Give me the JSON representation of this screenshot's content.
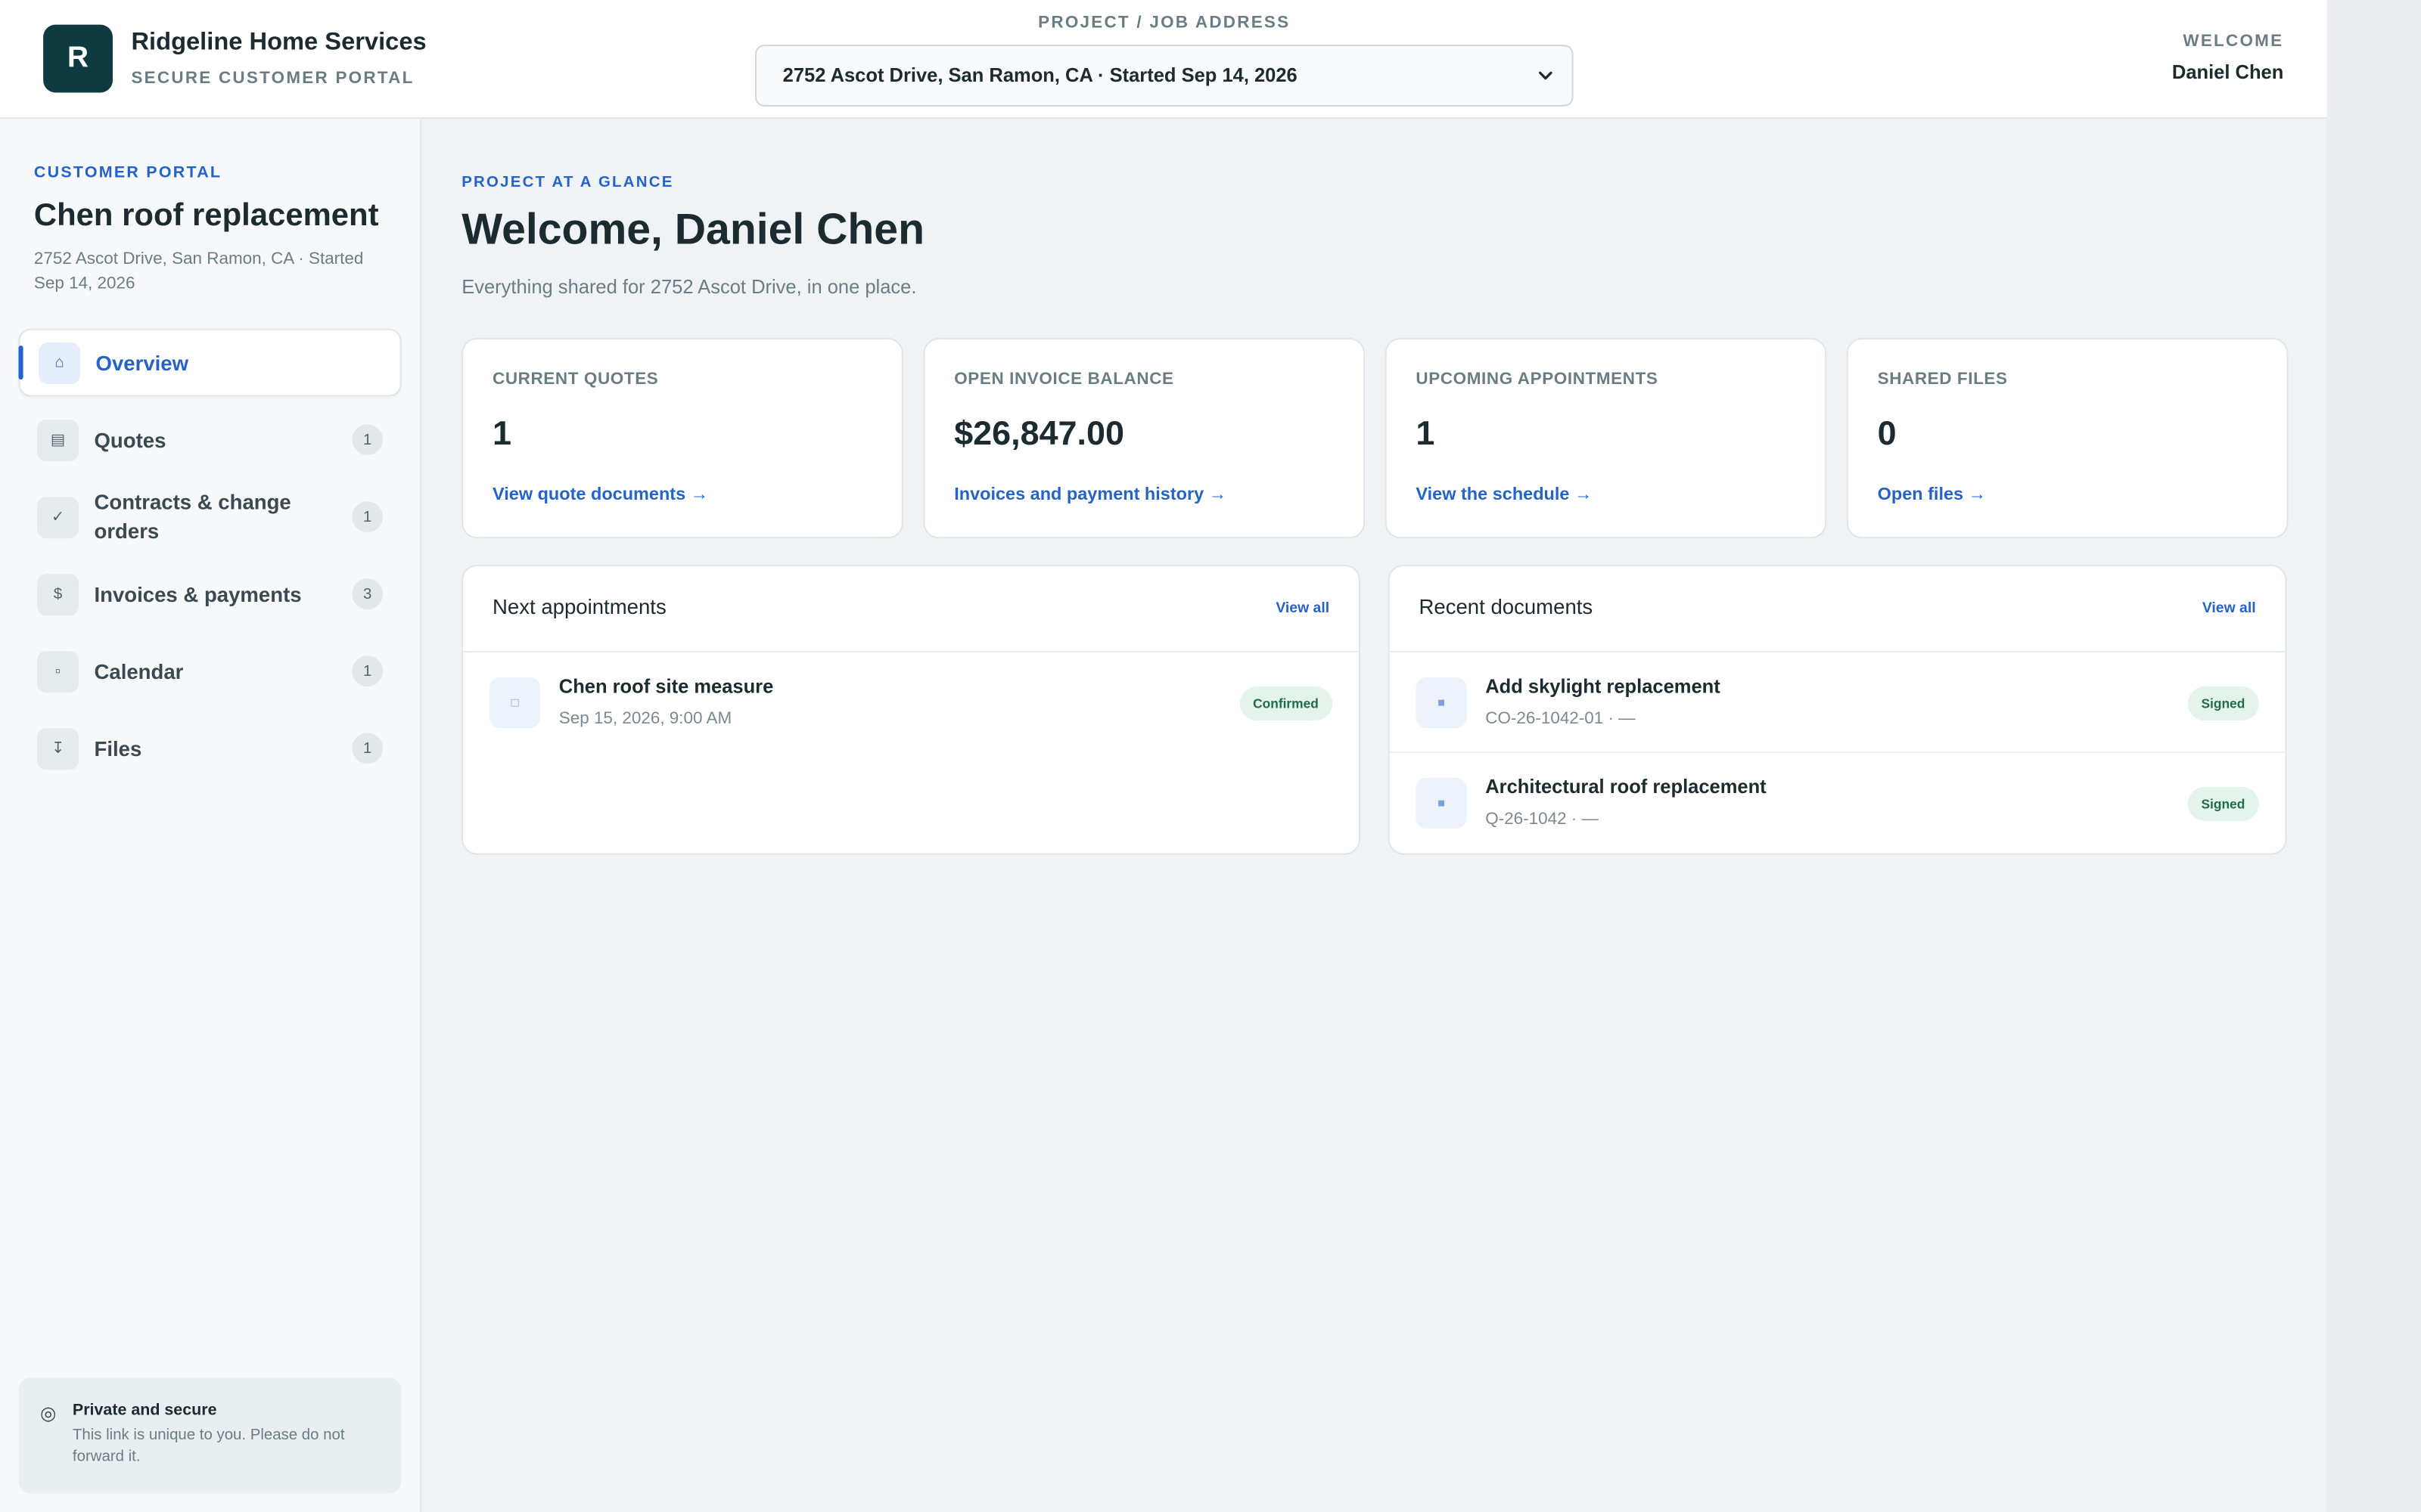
{
  "brand": {
    "initial": "R",
    "name": "Ridgeline Home Services",
    "subtitle": "SECURE CUSTOMER PORTAL"
  },
  "address_picker": {
    "label": "PROJECT / JOB ADDRESS",
    "selected": "2752 Ascot Drive, San Ramon, CA · Started Sep 14, 2026"
  },
  "user": {
    "welcome_label": "WELCOME",
    "name": "Daniel Chen"
  },
  "sidebar": {
    "eyebrow": "CUSTOMER PORTAL",
    "title": "Chen roof replacement",
    "meta": "2752 Ascot Drive, San Ramon, CA · Started Sep 14, 2026",
    "items": [
      {
        "label": "Overview",
        "icon": "⌂",
        "icon_name": "home-icon",
        "count": ""
      },
      {
        "label": "Quotes",
        "icon": "▤",
        "icon_name": "document-icon",
        "count": "1"
      },
      {
        "label": "Contracts & change orders",
        "icon": "✓",
        "icon_name": "check-icon",
        "count": "1"
      },
      {
        "label": "Invoices & payments",
        "icon": "$",
        "icon_name": "dollar-icon",
        "count": "3"
      },
      {
        "label": "Calendar",
        "icon": "▫",
        "icon_name": "calendar-icon",
        "count": "1"
      },
      {
        "label": "Files",
        "icon": "↧",
        "icon_name": "download-icon",
        "count": "1"
      }
    ],
    "secure_title": "Private and secure",
    "secure_desc": "This link is unique to you. Please do not forward it."
  },
  "main": {
    "eyebrow": "PROJECT AT A GLANCE",
    "title": "Welcome, Daniel Chen",
    "lead": "Everything shared for 2752 Ascot Drive, in one place.",
    "stats": [
      {
        "label": "CURRENT QUOTES",
        "value": "1",
        "link": "View quote documents →"
      },
      {
        "label": "OPEN INVOICE BALANCE",
        "value": "$26,847.00",
        "link": "Invoices and payment history →"
      },
      {
        "label": "UPCOMING APPOINTMENTS",
        "value": "1",
        "link": "View the schedule →"
      },
      {
        "label": "SHARED FILES",
        "value": "0",
        "link": "Open files →"
      }
    ],
    "appointments": {
      "title": "Next appointments",
      "view_all": "View all",
      "rows": [
        {
          "title": "Chen roof site measure",
          "sub": "Sep 15, 2026, 9:00 AM",
          "badge": "Confirmed"
        }
      ]
    },
    "documents": {
      "title": "Recent documents",
      "view_all": "View all",
      "rows": [
        {
          "title": "Add skylight replacement",
          "sub": "CO-26-1042-01 · —",
          "badge": "Signed"
        },
        {
          "title": "Architectural roof replacement",
          "sub": "Q-26-1042 · —",
          "badge": "Signed"
        }
      ]
    }
  },
  "colors": {
    "accent": "#2563c9",
    "brand": "#0f3b40",
    "success_bg": "#e4f3ec",
    "success_text": "#1e6e4b"
  }
}
